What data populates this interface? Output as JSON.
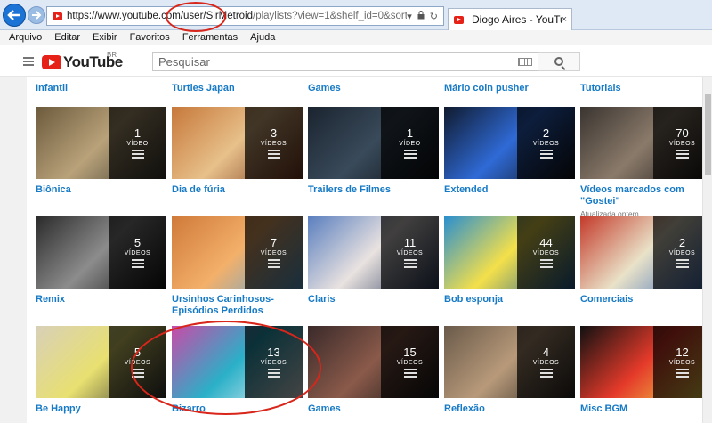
{
  "browser": {
    "url_prefix": "https://www.youtube.com/user/",
    "url_user": "SirMetroid",
    "url_rest": "/playlists?view=1&shelf_id=0&sort=dd",
    "tab_title": "Diogo Aires - YouTube",
    "tab_close": "×",
    "menu": [
      "Arquivo",
      "Editar",
      "Exibir",
      "Favoritos",
      "Ferramentas",
      "Ajuda"
    ]
  },
  "youtube": {
    "logo_text": "YouTube",
    "region": "BR",
    "search_placeholder": "Pesquisar"
  },
  "top_row_titles": [
    "Infantil",
    "Turtles Japan",
    "Games",
    "Mário coin pusher",
    "Tutoriais"
  ],
  "playlists": [
    {
      "title": "Biônica",
      "count": "1",
      "label": "VÍDEO",
      "meta": "",
      "colors": [
        "#6b5a3c",
        "#b9a27a",
        "#3c3a2e"
      ]
    },
    {
      "title": "Dia de fúria",
      "count": "3",
      "label": "VÍDEOS",
      "meta": "",
      "colors": [
        "#c7783a",
        "#e7c08a",
        "#7a3a1e"
      ]
    },
    {
      "title": "Trailers de Filmes",
      "count": "1",
      "label": "VÍDEO",
      "meta": "",
      "colors": [
        "#1b2430",
        "#394a5a",
        "#0b0f14"
      ]
    },
    {
      "title": "Extended",
      "count": "2",
      "label": "VÍDEOS",
      "meta": "",
      "colors": [
        "#101a2e",
        "#2f6ad6",
        "#111111"
      ]
    },
    {
      "title": "Vídeos marcados com \"Gostei\"",
      "count": "70",
      "label": "VÍDEOS",
      "meta": "Atualizada ontem",
      "colors": [
        "#3a3430",
        "#8a7a6a",
        "#1c1816"
      ]
    },
    {
      "title": "Remix",
      "count": "5",
      "label": "VÍDEOS",
      "meta": "",
      "colors": [
        "#2a2a2a",
        "#8c8c8c",
        "#111111"
      ]
    },
    {
      "title": "Ursinhos Carinhosos- Episódios Perdidos",
      "count": "7",
      "label": "VÍDEOS",
      "meta": "",
      "colors": [
        "#d07a3a",
        "#f3b06a",
        "#5aa6d8"
      ]
    },
    {
      "title": "Claris",
      "count": "11",
      "label": "VÍDEOS",
      "meta": "",
      "colors": [
        "#5a7fbf",
        "#e9e2e0",
        "#2a3b5a"
      ]
    },
    {
      "title": "Bob esponja",
      "count": "44",
      "label": "VÍDEOS",
      "meta": "",
      "colors": [
        "#2a8fcf",
        "#f4e04a",
        "#1d5f9a"
      ]
    },
    {
      "title": "Comerciais",
      "count": "2",
      "label": "VÍDEOS",
      "meta": "",
      "colors": [
        "#c43a2a",
        "#e9e2c8",
        "#3a6ab8"
      ]
    },
    {
      "title": "Be Happy",
      "count": "5",
      "label": "VÍDEOS",
      "meta": "",
      "colors": [
        "#d8d0b8",
        "#e8e070",
        "#333333"
      ]
    },
    {
      "title": "Bizarro",
      "count": "13",
      "label": "VÍDEOS",
      "meta": "",
      "colors": [
        "#c94aa8",
        "#2ab0c8",
        "#f4f4f4"
      ]
    },
    {
      "title": "Games",
      "count": "15",
      "label": "VÍDEOS",
      "meta": "",
      "colors": [
        "#3a2a2a",
        "#8a5a4a",
        "#151515"
      ]
    },
    {
      "title": "Reflexão",
      "count": "4",
      "label": "VÍDEOS",
      "meta": "",
      "colors": [
        "#6a5a4a",
        "#b89a7a",
        "#2a2420"
      ]
    },
    {
      "title": "Misc BGM",
      "count": "12",
      "label": "VÍDEOS",
      "meta": "",
      "colors": [
        "#111111",
        "#e43a2a",
        "#f4e04a"
      ]
    }
  ]
}
